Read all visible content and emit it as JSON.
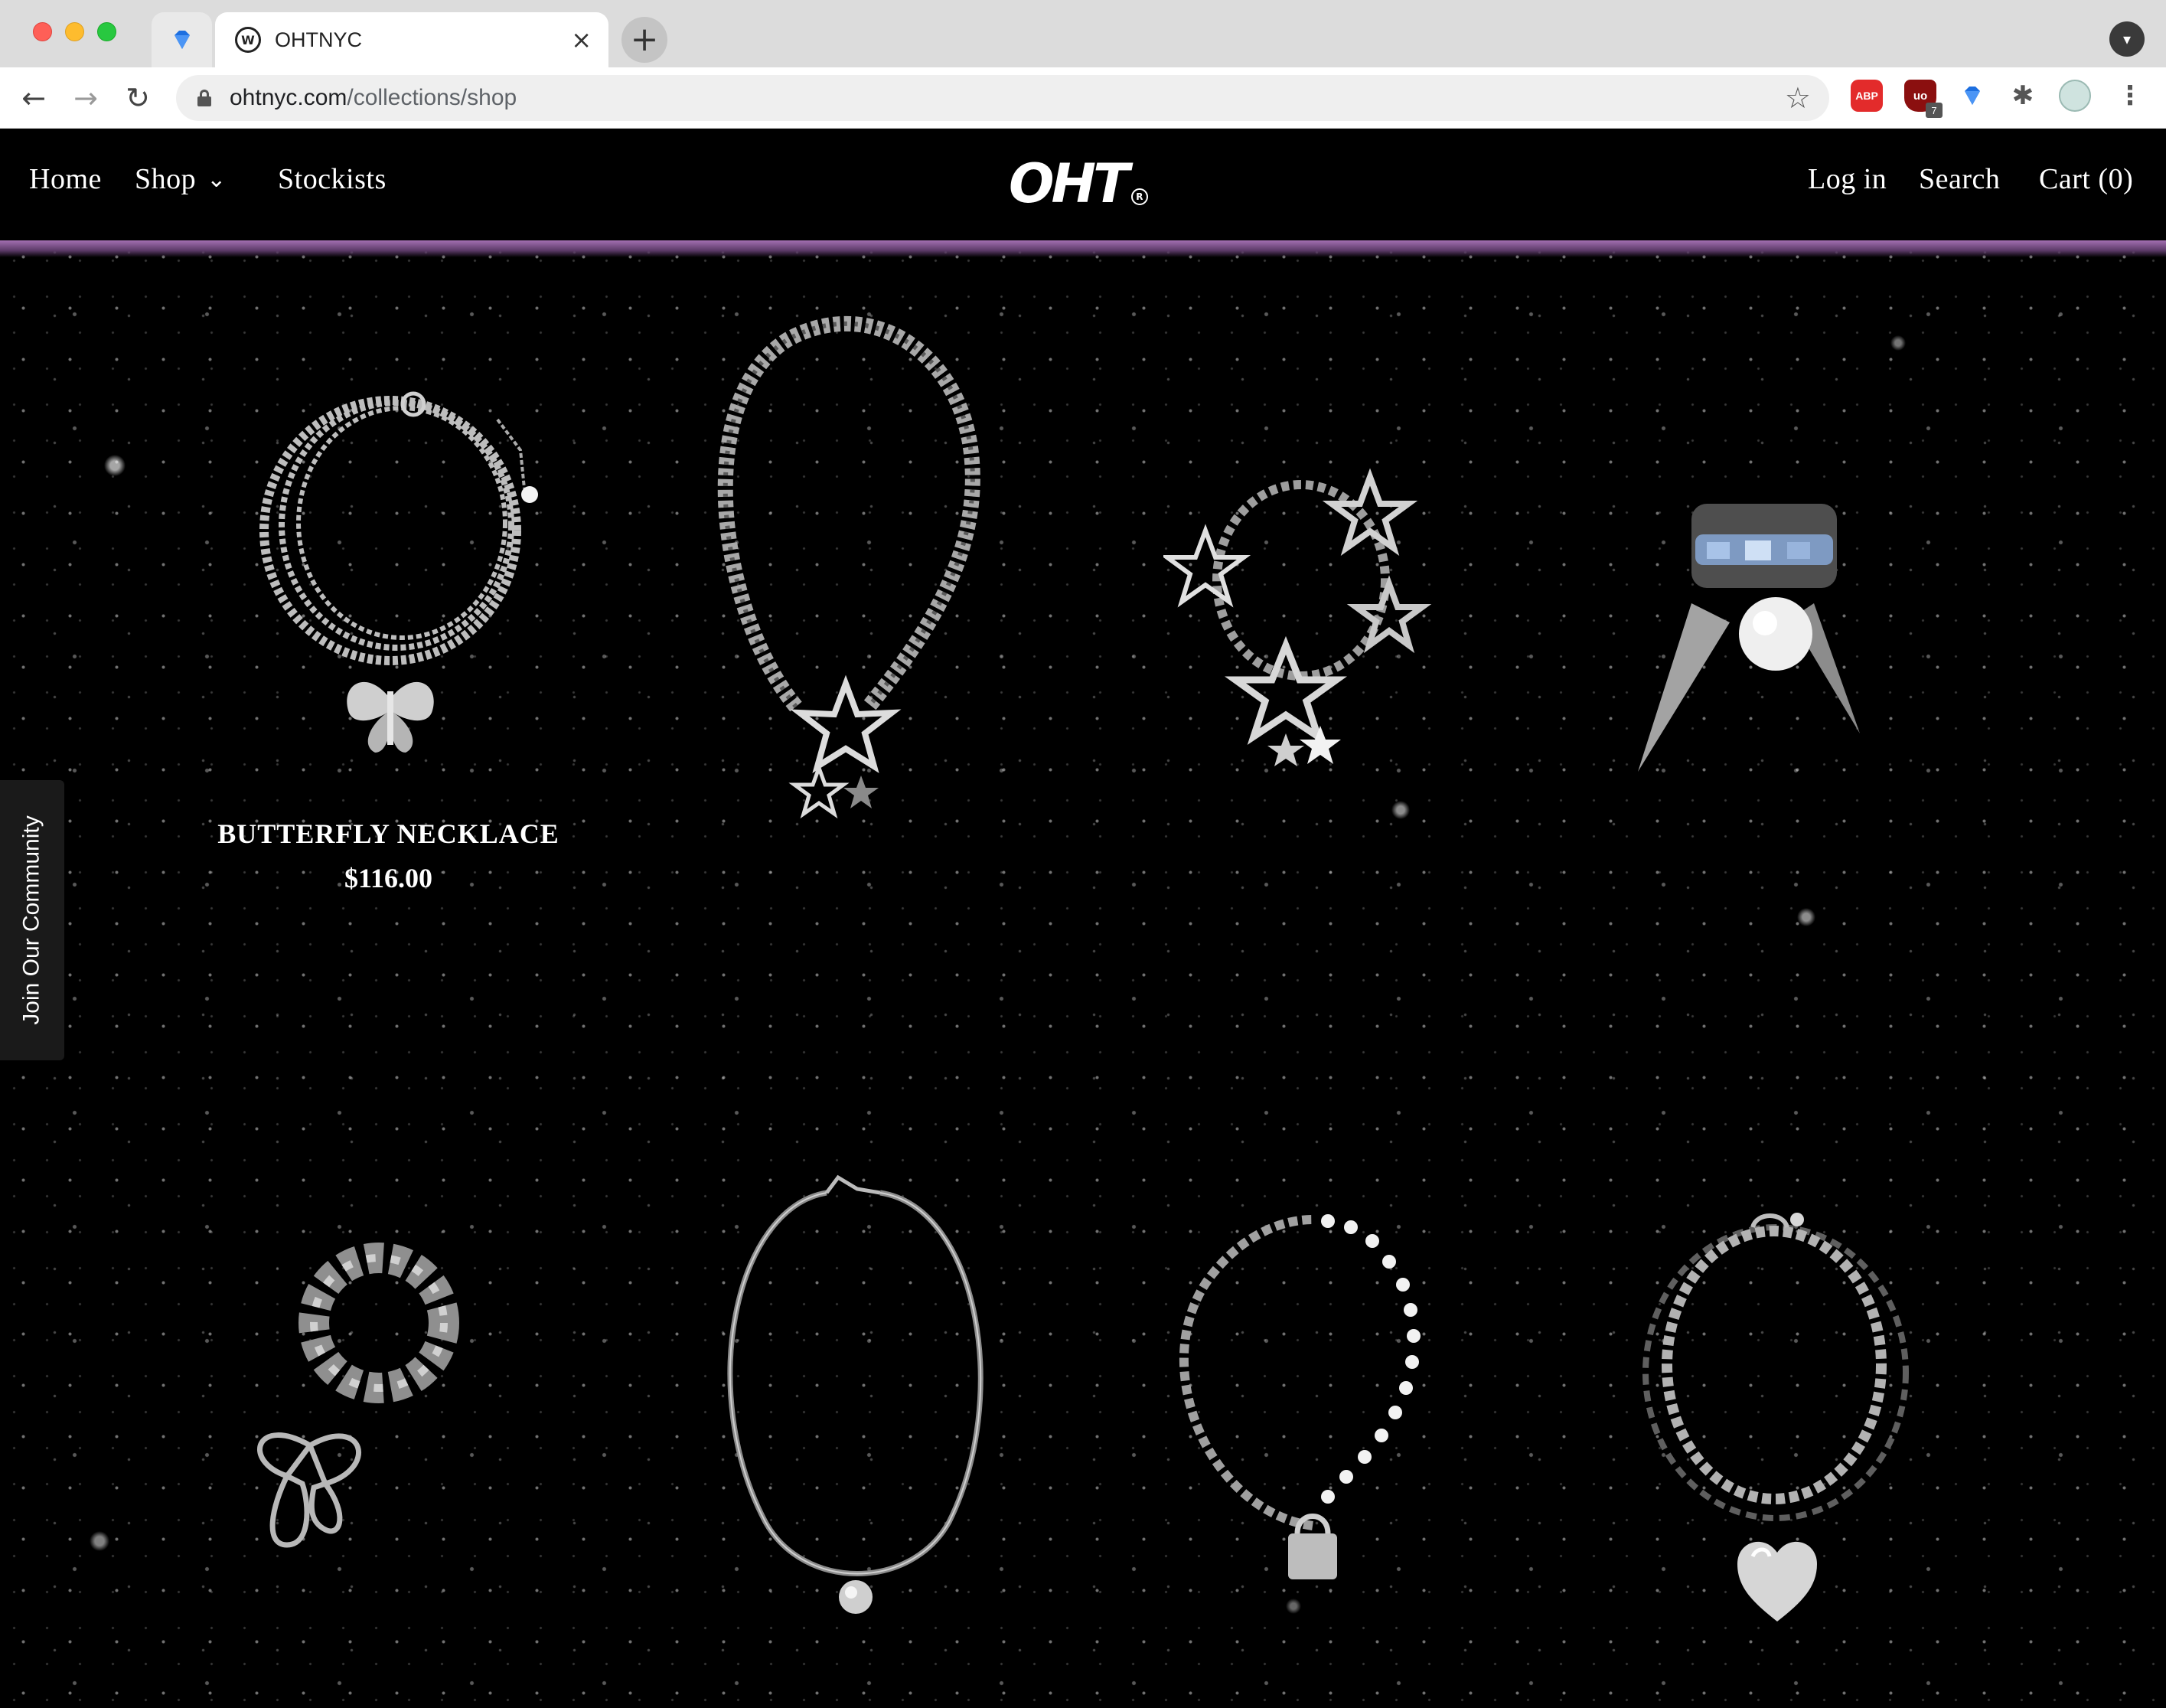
{
  "browser": {
    "tab_title": "OHTNYC",
    "tab_close": "×",
    "new_tab": "+",
    "url_host": "ohtnyc.com",
    "url_path": "/collections/shop",
    "ext_abp": "ABP",
    "ext_ub_badge": "7",
    "ext_ub": "uo"
  },
  "site": {
    "logo": "OHT",
    "logo_mark": "R",
    "nav_left": {
      "home": "Home",
      "shop": "Shop",
      "stockists": "Stockists"
    },
    "nav_right": {
      "login": "Log in",
      "search": "Search",
      "cart": "Cart (0)"
    },
    "community_tab": "Join Our Community",
    "products": [
      {
        "name": "BUTTERFLY NECKLACE",
        "price": "$116.00",
        "image": "chain-necklace-with-butterfly-pendant"
      },
      {
        "image": "curb-chain-necklace-with-star-charms"
      },
      {
        "image": "star-link-bracelet"
      },
      {
        "image": "crystal-ring-with-pearl-and-spikes"
      },
      {
        "image": "chain-ring-with-butterfly-charm"
      },
      {
        "image": "snake-chain-necklace-with-pearl"
      },
      {
        "image": "chain-and-pearl-bracelet-with-padlock"
      },
      {
        "image": "layered-chain-bracelet-with-heart"
      }
    ]
  }
}
